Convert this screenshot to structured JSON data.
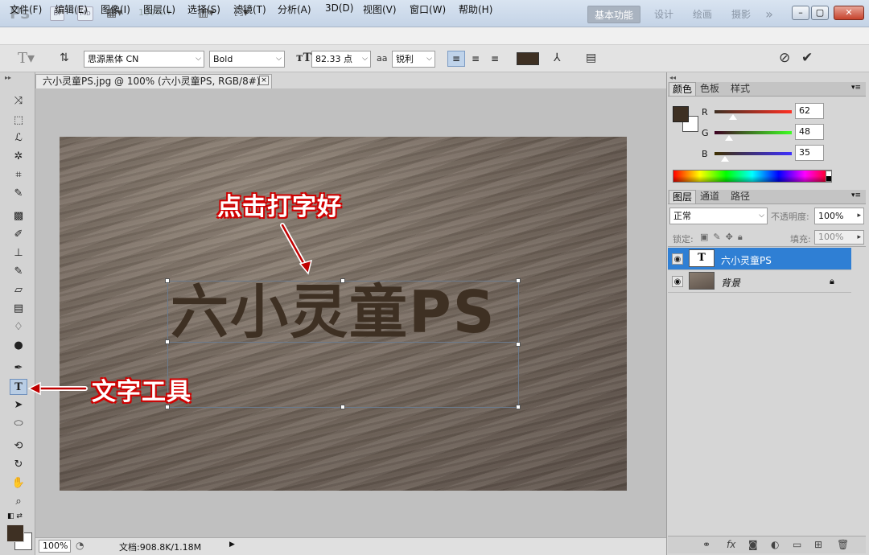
{
  "app": {
    "logo": "Ps",
    "bridge_label": "Br",
    "minibridge_label": "Mb",
    "zoom_value": "100%",
    "workspaces": [
      "基本功能",
      "设计",
      "绘画",
      "摄影"
    ],
    "more_symbol": "»"
  },
  "menu": [
    "文件(F)",
    "编辑(E)",
    "图像(I)",
    "图层(L)",
    "选择(S)",
    "滤镜(T)",
    "分析(A)",
    "3D(D)",
    "视图(V)",
    "窗口(W)",
    "帮助(H)"
  ],
  "options": {
    "font_family": "思源黑体 CN",
    "font_style": "Bold",
    "font_size": "82.33 点",
    "aa_label": "aa",
    "antialias": "锐利",
    "color": "#3e3023"
  },
  "document": {
    "tab_title": "六小灵童PS.jpg @ 100% (六小灵童PS, RGB/8#) *",
    "close_symbol": "×",
    "canvas_text": "六小灵童PS",
    "text_color": "#3e3023"
  },
  "annotations": {
    "click_to_type": "点击打字好",
    "text_tool": "文字工具"
  },
  "status": {
    "zoom": "100%",
    "doc_info": "文档:908.8K/1.18M"
  },
  "color_panel": {
    "tabs": [
      "颜色",
      "色板",
      "样式"
    ],
    "channels": [
      {
        "label": "R",
        "value": "62",
        "level": 0.243
      },
      {
        "label": "G",
        "value": "48",
        "level": 0.188
      },
      {
        "label": "B",
        "value": "35",
        "level": 0.137
      }
    ],
    "foreground": "#3e3023",
    "background": "#ffffff"
  },
  "layers_panel": {
    "tabs": [
      "图层",
      "通道",
      "路径"
    ],
    "blend_mode": "正常",
    "opacity_label": "不透明度:",
    "opacity": "100%",
    "lock_label": "锁定:",
    "fill_label": "填充:",
    "fill": "100%",
    "layers": [
      {
        "name": "六小灵童PS",
        "kind": "T",
        "selected": true
      },
      {
        "name": "背景",
        "kind": "image",
        "locked": true
      }
    ]
  }
}
